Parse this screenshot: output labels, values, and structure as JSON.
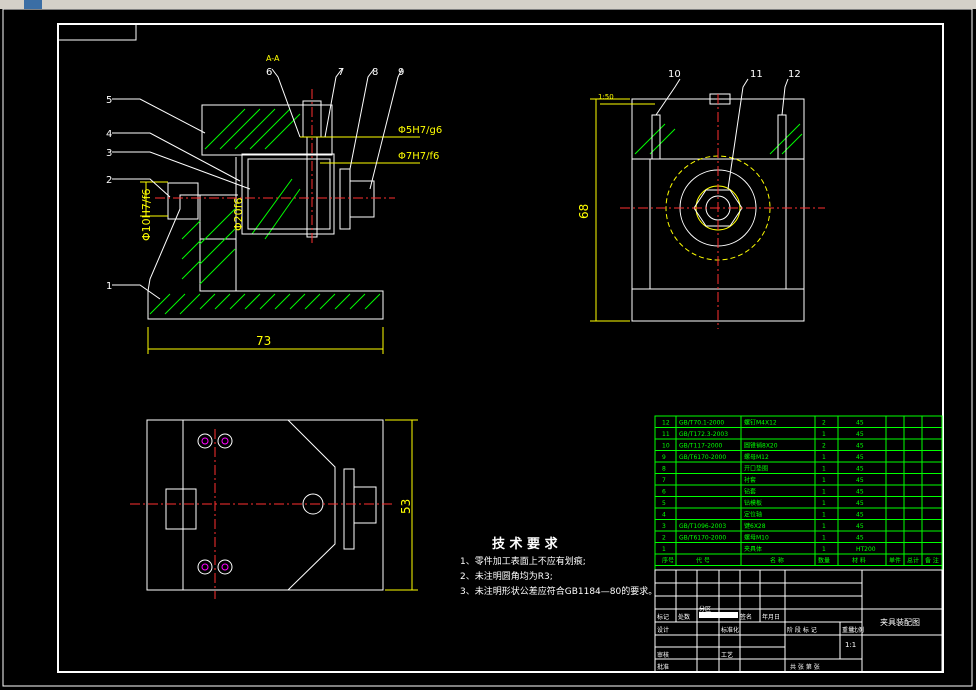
{
  "section_label": "A-A",
  "balloons_left": [
    "1",
    "2",
    "3",
    "4",
    "5",
    "6",
    "7",
    "8",
    "9"
  ],
  "balloons_right": [
    "10",
    "11",
    "12"
  ],
  "dims": {
    "d1": "Φ10H7/f6",
    "d2": "Φ20f6",
    "d3": "Φ5H7/g6",
    "d4": "Φ7H7/f6",
    "d5": "73",
    "d6": "68",
    "d7": "53",
    "taper": "1:50"
  },
  "tech": {
    "title": "技 术 要 求",
    "items": [
      "1、零件加工表面上不应有划痕;",
      "2、未注明圆角均为R3;",
      "3、未注明形状公差应符合GB1184—80的要求。"
    ]
  },
  "bom": [
    {
      "no": "12",
      "code": "GB/T70.1-2000",
      "name": "螺钉M4X12",
      "qty": "2",
      "mat": "45"
    },
    {
      "no": "11",
      "code": "GB/T172.3-2003",
      "name": "",
      "qty": "1",
      "mat": "45"
    },
    {
      "no": "10",
      "code": "GB/T117-2000",
      "name": "圆锥销8X20",
      "qty": "2",
      "mat": "45"
    },
    {
      "no": "9",
      "code": "GB/T6170-2000",
      "name": "螺母M12",
      "qty": "1",
      "mat": "45"
    },
    {
      "no": "8",
      "code": "",
      "name": "开口垫圈",
      "qty": "1",
      "mat": "45"
    },
    {
      "no": "7",
      "code": "",
      "name": "衬套",
      "qty": "1",
      "mat": "45"
    },
    {
      "no": "6",
      "code": "",
      "name": "钻套",
      "qty": "1",
      "mat": "45"
    },
    {
      "no": "5",
      "code": "",
      "name": "钻模板",
      "qty": "1",
      "mat": "45"
    },
    {
      "no": "4",
      "code": "",
      "name": "定位轴",
      "qty": "1",
      "mat": "45"
    },
    {
      "no": "3",
      "code": "GB/T1096-2003",
      "name": "键6X28",
      "qty": "1",
      "mat": "45"
    },
    {
      "no": "2",
      "code": "GB/T6170-2000",
      "name": "螺母M10",
      "qty": "1",
      "mat": "45"
    },
    {
      "no": "1",
      "code": "",
      "name": "夹具体",
      "qty": "1",
      "mat": "HT200"
    }
  ],
  "bom_header": {
    "no": "序号",
    "code": "代 号",
    "name": "名 称",
    "qty": "数量",
    "mat": "材 料",
    "wt1": "单件",
    "wt2": "总计",
    "note": "备 注"
  },
  "title_block": {
    "drawing_name": "夹具装配图",
    "row1": [
      "标记",
      "处数",
      "分区",
      "更改文件号",
      "签名",
      "年月日"
    ],
    "design": "设计",
    "std": "标准化",
    "stage": "阶 段 标 记",
    "weight": "重量",
    "scale_label": "比例",
    "check": "审核",
    "process": "工艺",
    "approve": "批准",
    "scale": "1:1",
    "sheet": "共    张  第    张",
    "blank_rows": [
      "",
      "",
      "",
      "",
      "",
      ""
    ]
  }
}
